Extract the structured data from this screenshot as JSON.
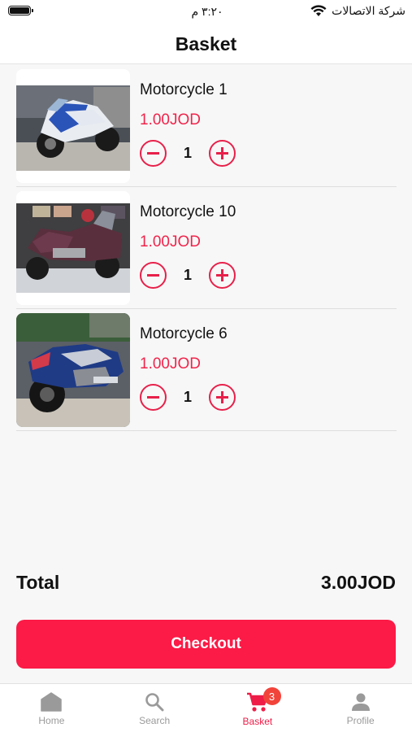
{
  "status_bar": {
    "time": "٣:٢٠ م",
    "carrier": "شركة الاتصالات",
    "icons": [
      "battery-icon",
      "wifi-icon"
    ]
  },
  "header": {
    "title": "Basket"
  },
  "cart": {
    "items": [
      {
        "name": "Motorcycle 1",
        "price": "1.00JOD",
        "quantity": "1",
        "image": "sport-motorcycle-photo"
      },
      {
        "name": "Motorcycle 10",
        "price": "1.00JOD",
        "quantity": "1",
        "image": "touring-motorcycle-photo"
      },
      {
        "name": "Motorcycle 6",
        "price": "1.00JOD",
        "quantity": "1",
        "image": "cruiser-motorcycle-photo"
      }
    ]
  },
  "summary": {
    "total_label": "Total",
    "total_value": "3.00JOD"
  },
  "checkout": {
    "label": "Checkout"
  },
  "tab_bar": {
    "tabs": [
      {
        "label": "Home",
        "icon": "home-icon",
        "active": false
      },
      {
        "label": "Search",
        "icon": "search-icon",
        "active": false
      },
      {
        "label": "Basket",
        "icon": "cart-icon",
        "active": true,
        "badge": "3"
      },
      {
        "label": "Profile",
        "icon": "person-icon",
        "active": false
      }
    ]
  },
  "colors": {
    "accent": "#fc1a46",
    "price": "#f0244b",
    "badge": "#f2433a",
    "inactive_tab": "#9a9a9a"
  }
}
